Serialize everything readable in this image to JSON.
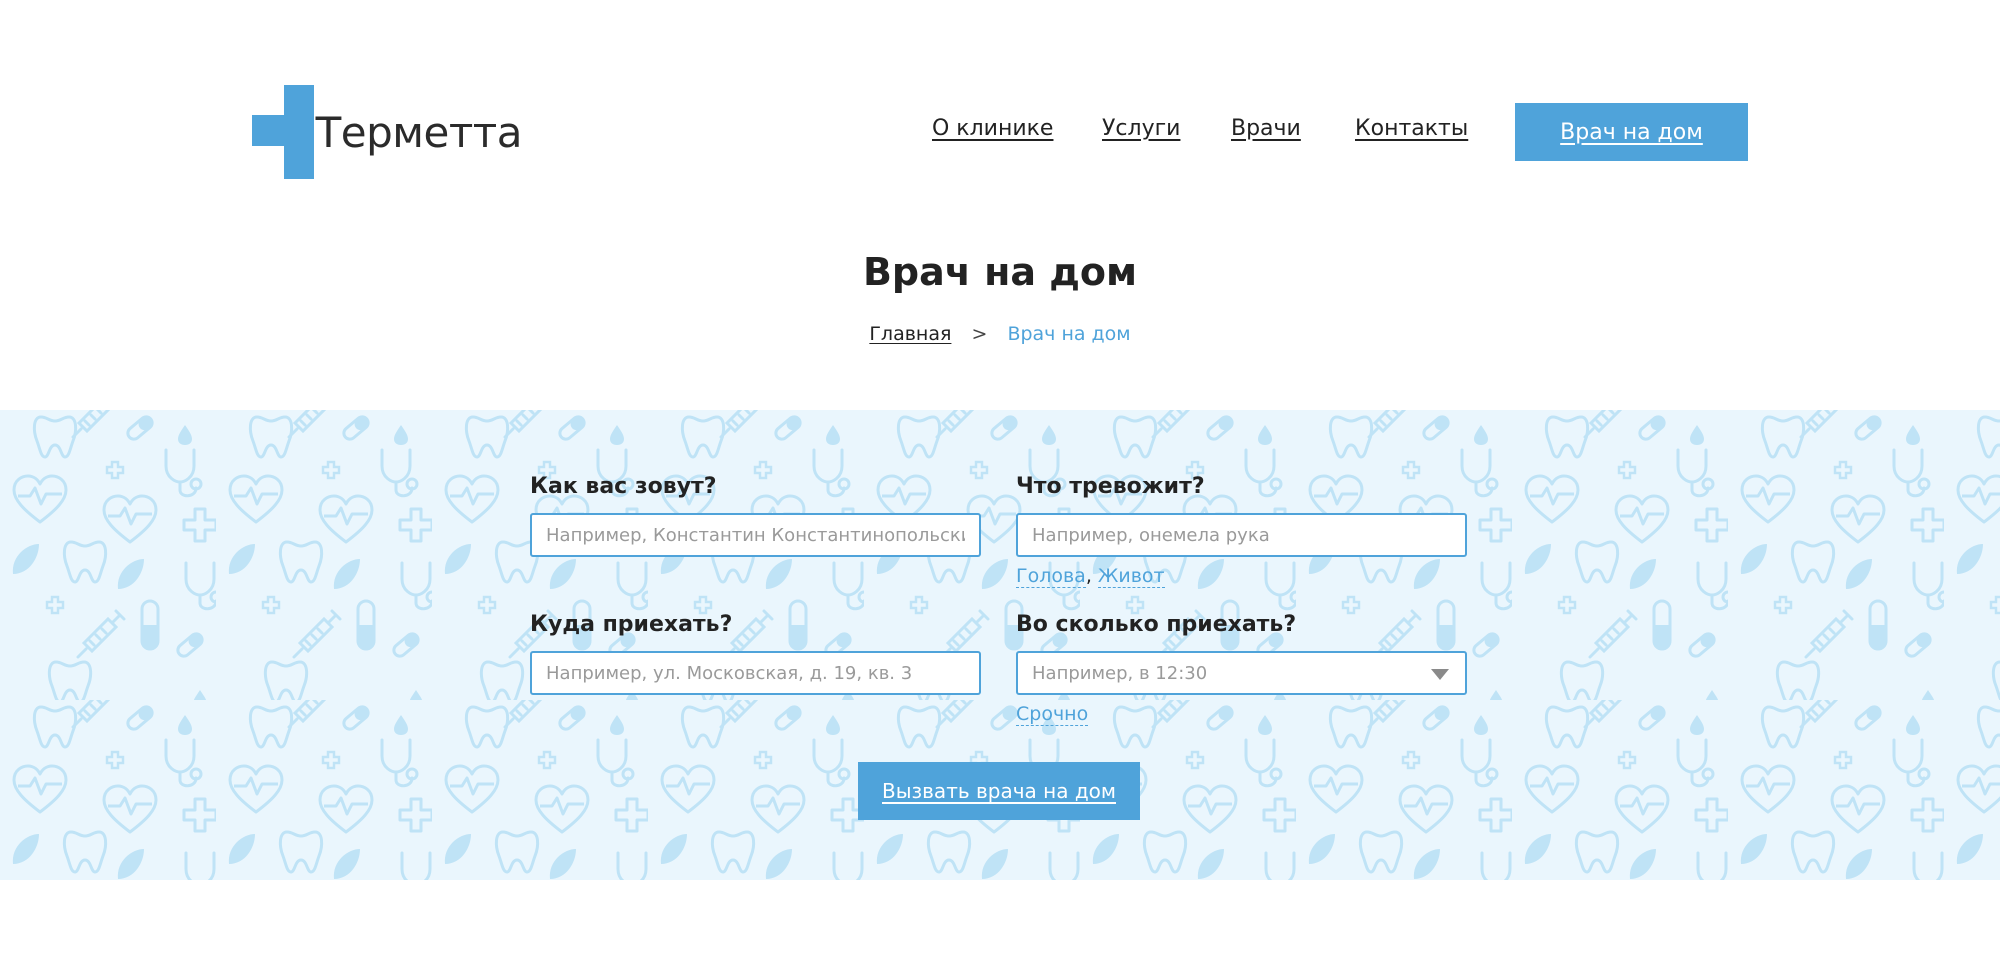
{
  "brand": {
    "name": "Терметта",
    "accent_color": "#4fa3da"
  },
  "nav": {
    "items": [
      {
        "label": "О клинике"
      },
      {
        "label": "Услуги"
      },
      {
        "label": "Врачи"
      },
      {
        "label": "Контакты"
      }
    ],
    "cta_label": "Врач на дом"
  },
  "page": {
    "title": "Врач на дом"
  },
  "breadcrumb": {
    "home": "Главная",
    "separator": ">",
    "current": "Врач на дом"
  },
  "form": {
    "name": {
      "label": "Как вас зовут?",
      "placeholder": "Например, Константин Константинопольский"
    },
    "complaint": {
      "label": "Что тревожит?",
      "placeholder": "Например, онемела рука",
      "suggestions": [
        "Голова",
        "Живот"
      ],
      "suggestion_separator": ","
    },
    "address": {
      "label": "Куда приехать?",
      "placeholder": "Например, ул. Московская, д. 19, кв. 3"
    },
    "time": {
      "label": "Во сколько приехать?",
      "placeholder": "Например, в 12:30",
      "quick_option": "Срочно"
    },
    "submit_label": "Вызвать врача на дом"
  },
  "icons": {
    "logo": "medical-cross-icon",
    "select": "chevron-down-icon",
    "pattern": [
      "tooth-icon",
      "heart-pulse-icon",
      "plus-icon",
      "pill-icon",
      "stethoscope-icon",
      "syringe-icon",
      "leaf-icon",
      "drop-icon",
      "capsule-icon"
    ]
  }
}
